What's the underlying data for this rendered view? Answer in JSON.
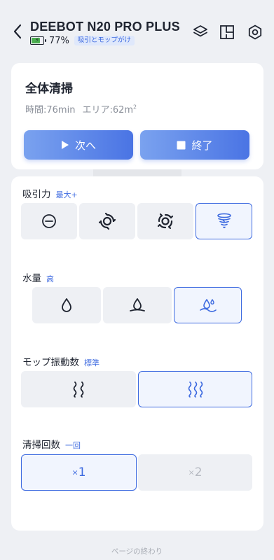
{
  "header": {
    "device_name": "DEEBOT N20 PRO PLUS",
    "battery_percent": "77%",
    "battery_level": 0.77,
    "mode_badge": "吸引とモップがけ"
  },
  "task": {
    "title": "全体清掃",
    "time": "時間:76min",
    "area": "エリア:62m",
    "area_unit_exp": "2",
    "next_label": "次へ",
    "end_label": "終了"
  },
  "suction": {
    "label": "吸引力",
    "value": "最大+",
    "options": [
      "quiet-icon",
      "standard-icon",
      "max-icon",
      "max-plus-icon"
    ],
    "selected_index": 3
  },
  "water": {
    "label": "水量",
    "value": "高",
    "options": [
      "water-low-icon",
      "water-medium-icon",
      "water-high-icon"
    ],
    "selected_index": 2
  },
  "mop": {
    "label": "モップ振動数",
    "value": "標準",
    "options": [
      "vibration-low-icon",
      "vibration-standard-icon"
    ],
    "selected_index": 1
  },
  "passes": {
    "label": "清掃回数",
    "value": "一回",
    "option1": "1",
    "option2": "2",
    "times_symbol": "×",
    "selected_index": 0
  },
  "footer": {
    "text": "ページの終わり"
  },
  "colors": {
    "accent": "#3d6ae0",
    "background": "#eef0f4",
    "card": "#ffffff"
  }
}
